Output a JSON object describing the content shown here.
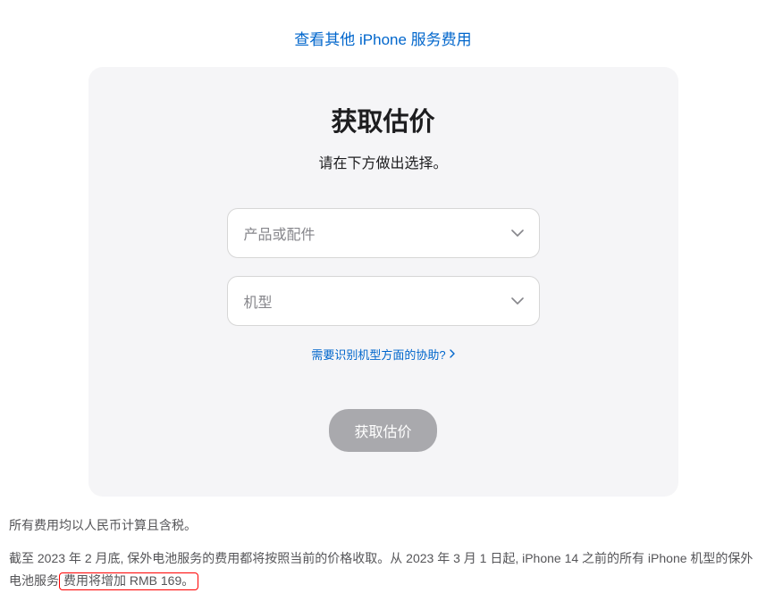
{
  "header": {
    "link_text": "查看其他 iPhone 服务费用"
  },
  "card": {
    "title": "获取估价",
    "subtitle": "请在下方做出选择。",
    "select_product_placeholder": "产品或配件",
    "select_model_placeholder": "机型",
    "help_link": "需要识别机型方面的协助?",
    "submit_label": "获取估价"
  },
  "footer": {
    "line1": "所有费用均以人民币计算且含税。",
    "line2_part1": "截至 2023 年 2 月底, 保外电池服务的费用都将按照当前的价格收取。从 2023 年 3 月 1 日起, iPhone 14 之前的所有 iPhone 机型的保外电池服务",
    "line2_highlight": "费用将增加 RMB 169。"
  }
}
